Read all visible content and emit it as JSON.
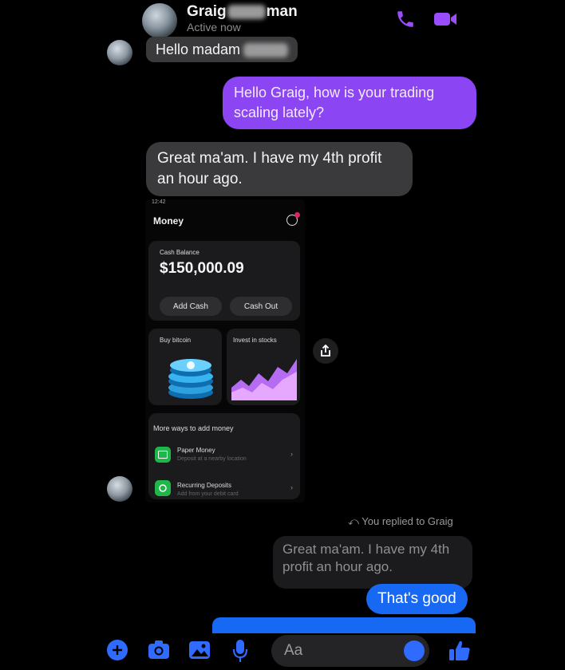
{
  "header": {
    "contact_name": "Graig",
    "contact_name_tail": "man",
    "status": "Active now"
  },
  "messages": {
    "m1": "Hello madam",
    "m2": "Hello Graig, how is your trading scaling lately?",
    "m3": "Great ma'am. I have my 4th profit an hour ago.",
    "reply_indicator": "You replied to Graig",
    "quoted": "Great ma'am. I have my 4th profit an hour ago.",
    "m4": "That's good"
  },
  "shot": {
    "time": "12:42",
    "title": "Money",
    "balance_label": "Cash Balance",
    "balance_value": "$150,000.09",
    "add_cash": "Add Cash",
    "cash_out": "Cash Out",
    "buy_bitcoin": "Buy bitcoin",
    "invest_stocks": "Invest in stocks",
    "more_ways": "More ways to add money",
    "paper_money": "Paper Money",
    "paper_money_sub": "Deposit at a nearby location",
    "recurring": "Recurring Deposits",
    "recurring_sub": "Add from your debit card"
  },
  "composer": {
    "placeholder": "Aa"
  },
  "colors": {
    "purple_bubble": "#8b45f3",
    "blue_bubble": "#1768f2",
    "incoming_bubble": "#3a3a3c",
    "accent": "#2f6bff"
  }
}
